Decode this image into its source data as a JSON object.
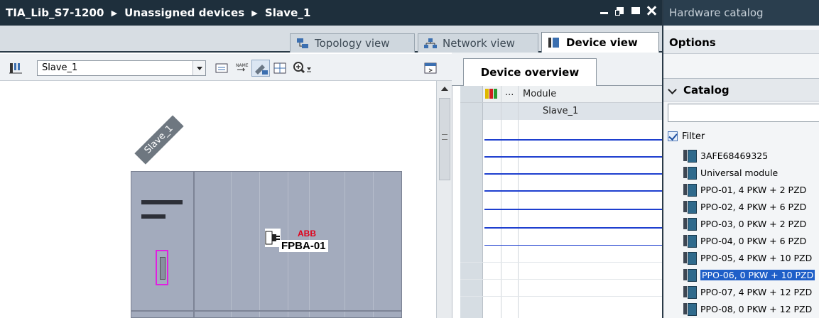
{
  "editor": {
    "breadcrumb": [
      "TIA_Lib_S7-1200",
      "Unassigned devices",
      "Slave_1"
    ]
  },
  "view_tabs": [
    {
      "label": "Topology view",
      "active": false
    },
    {
      "label": "Network view",
      "active": false
    },
    {
      "label": "Device view",
      "active": true
    }
  ],
  "toolbar": {
    "device_select_value": "Slave_1"
  },
  "canvas": {
    "device_name": "Slave_1",
    "module_brand": "ABB",
    "module_name": "FPBA-01"
  },
  "overview": {
    "tab_label": "Device overview",
    "header_dots": "...",
    "header_module": "Module",
    "rows": [
      {
        "module": "Slave_1"
      }
    ]
  },
  "catalog": {
    "title": "Hardware catalog",
    "options_label": "Options",
    "catalog_label": "Catalog",
    "search_value": "",
    "filter_label": "Filter",
    "filter_checked": true,
    "items": [
      {
        "label": "3AFE68469325",
        "selected": false
      },
      {
        "label": "Universal module",
        "selected": false
      },
      {
        "label": "PPO-01, 4 PKW + 2 PZD",
        "selected": false
      },
      {
        "label": "PPO-02, 4 PKW + 6 PZD",
        "selected": false
      },
      {
        "label": "PPO-03, 0 PKW + 2 PZD",
        "selected": false
      },
      {
        "label": "PPO-04, 0 PKW + 6 PZD",
        "selected": false
      },
      {
        "label": "PPO-05, 4 PKW + 10 PZD",
        "selected": false
      },
      {
        "label": "PPO-06, 0 PKW + 10 PZD",
        "selected": true
      },
      {
        "label": "PPO-07, 4 PKW + 12 PZD",
        "selected": false
      },
      {
        "label": "PPO-08, 0 PKW + 12 PZD",
        "selected": false
      }
    ]
  },
  "colors": {
    "title_bar": "#1e2f3c",
    "selection": "#1f5fc8",
    "rack": "#a3abbd",
    "connector_highlight": "#e020e0",
    "abb_red": "#e0001a"
  }
}
